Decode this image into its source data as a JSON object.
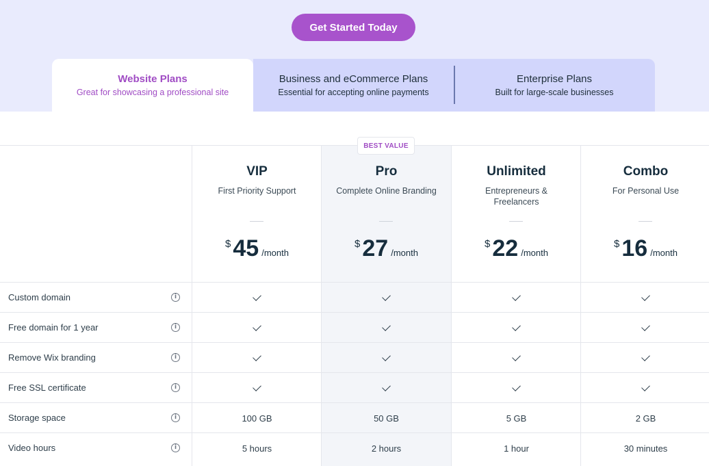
{
  "cta": {
    "label": "Get Started Today"
  },
  "tabs": [
    {
      "title": "Website Plans",
      "subtitle": "Great for showcasing a professional site"
    },
    {
      "title": "Business and eCommerce Plans",
      "subtitle": "Essential for accepting online payments"
    },
    {
      "title": "Enterprise Plans",
      "subtitle": "Built for large-scale businesses"
    }
  ],
  "badge": "BEST VALUE",
  "plans": [
    {
      "name": "VIP",
      "tagline": "First Priority Support",
      "currency": "$",
      "price": "45",
      "period": "/month"
    },
    {
      "name": "Pro",
      "tagline": "Complete Online Branding",
      "currency": "$",
      "price": "27",
      "period": "/month"
    },
    {
      "name": "Unlimited",
      "tagline": "Entrepreneurs & Freelancers",
      "currency": "$",
      "price": "22",
      "period": "/month"
    },
    {
      "name": "Combo",
      "tagline": "For Personal Use",
      "currency": "$",
      "price": "16",
      "period": "/month"
    }
  ],
  "info_icon_glyph": "i",
  "features": [
    {
      "label": "Custom domain",
      "values": [
        "check",
        "check",
        "check",
        "check"
      ]
    },
    {
      "label": "Free domain for 1 year",
      "values": [
        "check",
        "check",
        "check",
        "check"
      ]
    },
    {
      "label": "Remove Wix branding",
      "values": [
        "check",
        "check",
        "check",
        "check"
      ]
    },
    {
      "label": "Free SSL certificate",
      "values": [
        "check",
        "check",
        "check",
        "check"
      ]
    },
    {
      "label": "Storage space",
      "values": [
        "100 GB",
        "50 GB",
        "5 GB",
        "2 GB"
      ]
    },
    {
      "label": "Video hours",
      "values": [
        "5 hours",
        "2 hours",
        "1 hour",
        "30 minutes"
      ]
    }
  ],
  "colors": {
    "accent": "#a853cc",
    "hero_bg": "#e9ebfd",
    "tab_inactive_bg": "#d2d6fc",
    "pro_col_bg": "#f3f5f9"
  }
}
